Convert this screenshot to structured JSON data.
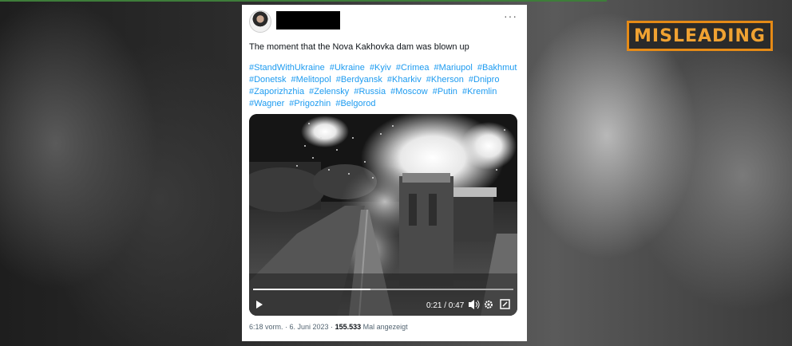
{
  "badge": {
    "label": "MISLEADING",
    "color": "#e58a16"
  },
  "tweet": {
    "more_icon": "ellipsis-icon",
    "text": "The moment that the Nova Kakhovka dam was blown up",
    "hashtags": [
      "#StandWithUkraine",
      "#Ukraine",
      "#Kyiv",
      "#Crimea",
      "#Mariupol",
      "#Bakhmut",
      "#Donetsk",
      "#Melitopol",
      "#Berdyansk",
      "#Kharkiv",
      "#Kherson",
      "#Dnipro",
      "#Zaporizhzhia",
      "#Zelensky",
      "#Russia",
      "#Moscow",
      "#Putin",
      "#Kremlin",
      "#Wagner",
      "#Prigozhin",
      "#Belgorod"
    ],
    "video": {
      "time": "0:21 / 0:47",
      "progress": 0.45
    },
    "footer": {
      "time_date": "6:18 vorm. · 6. Juni 2023 · ",
      "views": "155.533",
      "views_label": " Mal angezeigt"
    }
  }
}
